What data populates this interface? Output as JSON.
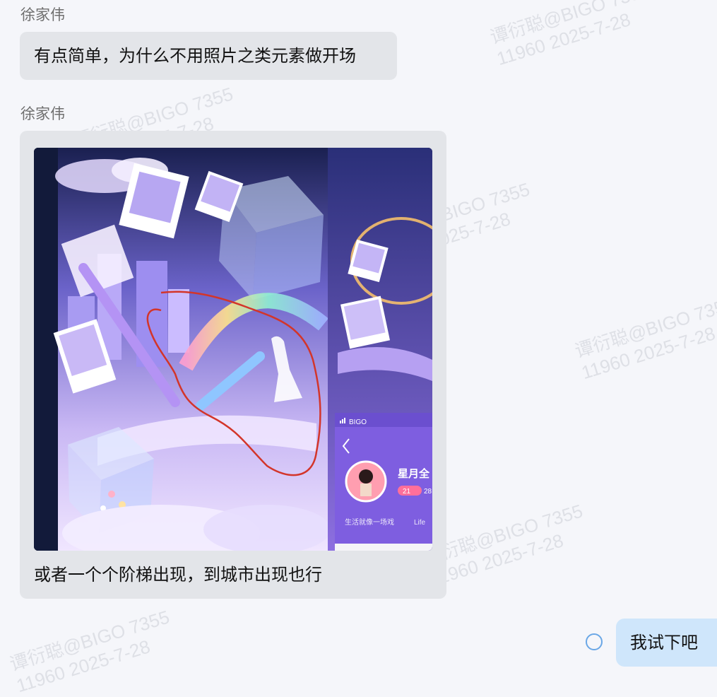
{
  "messages": [
    {
      "sender": "徐家伟",
      "text": "有点简单，为什么不用照片之类元素做开场"
    },
    {
      "sender": "徐家伟",
      "text": "或者一个个阶梯出现，到城市出现也行"
    }
  ],
  "reply": {
    "text": "我试下吧"
  },
  "image_overlay": {
    "status_brand": "BIGO",
    "room_name": "星月全",
    "room_count": "21",
    "room_count2": "28",
    "room_desc": "生活就像一场戏",
    "room_desc2": "Life"
  },
  "watermarks": [
    {
      "line1": "谭衍聪@BIGO 7355",
      "line2": "11960 2025-7-28"
    }
  ],
  "colors": {
    "bubble_incoming": "#e3e5e9",
    "bubble_outgoing": "#cfe6fb",
    "status_ring": "#6aa7e6",
    "annotation_red": "#d3352a"
  }
}
